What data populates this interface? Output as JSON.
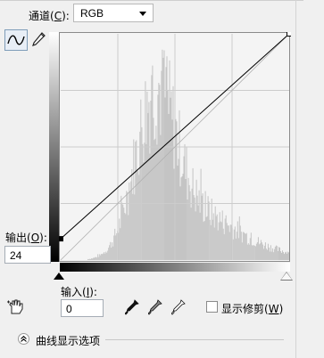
{
  "channel": {
    "label_prefix": "通道(",
    "label_key": "C",
    "label_suffix": "):",
    "value": "RGB"
  },
  "tools": {
    "curve_tool": "curve-edit-icon",
    "pencil_tool": "pencil-icon",
    "hand_tool": "target-adjust-hand-icon"
  },
  "output": {
    "label_prefix": "输出(",
    "label_key": "O",
    "label_suffix": "):",
    "value": "24"
  },
  "input": {
    "label_prefix": "输入(",
    "label_key": "I",
    "label_suffix": "):",
    "value": "0"
  },
  "eyedroppers": [
    "black-point-eyedropper-icon",
    "gray-point-eyedropper-icon",
    "white-point-eyedropper-icon"
  ],
  "show_clipping": {
    "label_prefix": "显示修剪(",
    "label_key": "W",
    "label_suffix": ")",
    "checked": false
  },
  "curve_display_options": {
    "label": "曲线显示选项",
    "expanded": false
  },
  "curve": {
    "points": [
      [
        0,
        24
      ],
      [
        255,
        255
      ]
    ],
    "baseline": [
      [
        0,
        0
      ],
      [
        255,
        255
      ]
    ]
  },
  "colors": {
    "histogram": "#c4c4c4",
    "curve": "#000000",
    "grid": "#cccccc",
    "graph_bg": "#f4f4f4"
  }
}
